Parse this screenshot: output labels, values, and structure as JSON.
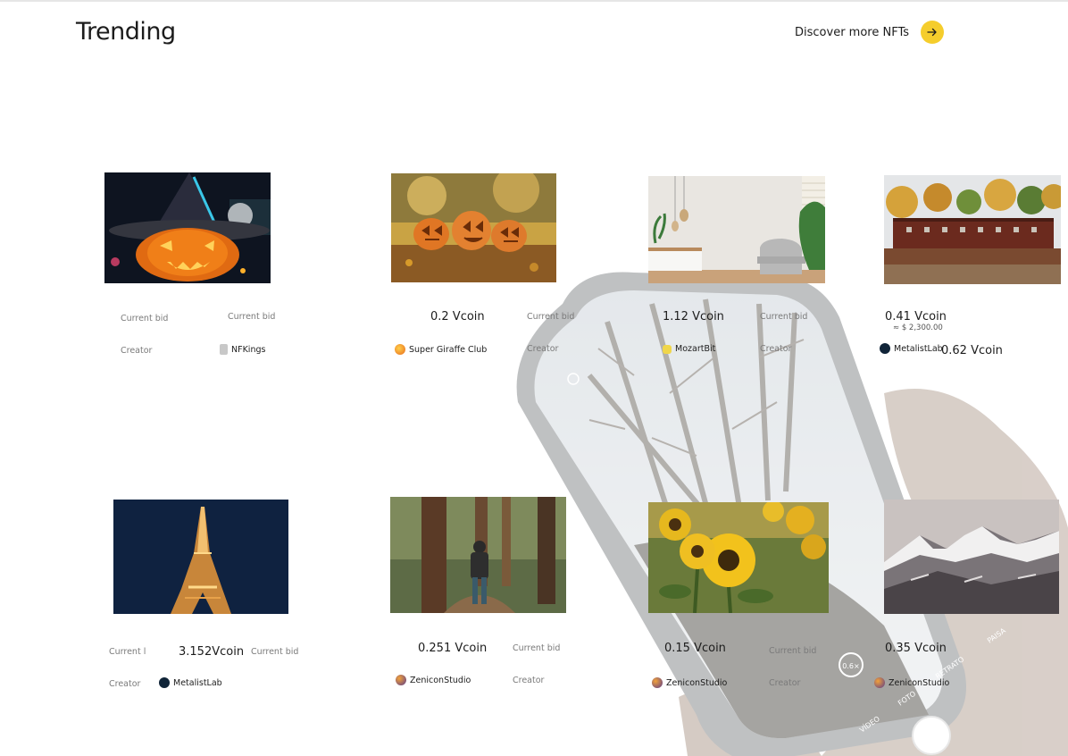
{
  "header": {
    "title": "Trending",
    "discover_label": "Discover more NFTs"
  },
  "colors": {
    "accent": "#f5cd2c",
    "text": "#1c1c1c",
    "muted": "#7a7a7a"
  },
  "cards": [
    {
      "image": "halloween-pumpkin-witch-hat",
      "current_bid_label": "Current bid",
      "current_bid_label_2": "Current bid",
      "creator_label": "Creator",
      "creator": "NFKings"
    },
    {
      "image": "carved-pumpkins-autumn-leaves",
      "price": "0.2 Vcoin",
      "current_bid_label": "Current bid",
      "creator_label": "Creator",
      "creator": "Super Giraffe Club"
    },
    {
      "image": "living-room-armchair",
      "price": "1.12 Vcoin",
      "current_bid_label": "Current bid",
      "creator_label": "Creator",
      "creator": "MozartBit"
    },
    {
      "image": "red-boathouse-lake",
      "price": "0.41 Vcoin",
      "usd": "≈ $ 2,300.00",
      "creator": "MetalistLab",
      "price_2": "0.62 Vcoin"
    },
    {
      "image": "eiffel-tower-night",
      "current_bid_label": "Current l",
      "price": "3.152Vcoin",
      "current_bid_label_2": "Current bid",
      "creator_label": "Creator",
      "creator": "MetalistLab"
    },
    {
      "image": "hiker-forest-trail",
      "price": "0.251 Vcoin",
      "current_bid_label": "Current bid",
      "creator_label": "Creator",
      "creator": "ZeniconStudio"
    },
    {
      "image": "sunflower-field",
      "price": "0.15 Vcoin",
      "current_bid_label": "Current bid",
      "creator_label": "Creator",
      "creator": "ZeniconStudio"
    },
    {
      "image": "snowy-mountains",
      "price": "0.35 Vcoin",
      "creator": "ZeniconStudio"
    }
  ],
  "phone_camera": {
    "zoom_label": "0.6×",
    "modes": [
      "VÍDEO",
      "FOTO",
      "RETRATO",
      "PAISA"
    ]
  }
}
